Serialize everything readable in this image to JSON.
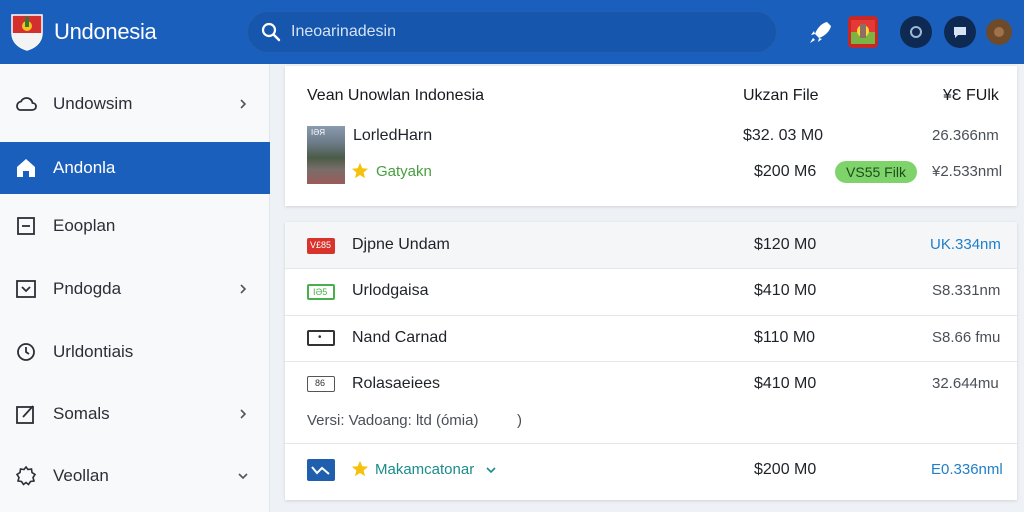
{
  "header": {
    "app_title": "Undonesia",
    "search_placeholder": "Inеоаrinаdеsin"
  },
  "sidebar": {
    "items": [
      {
        "label": "Undowsim",
        "icon": "cloud-icon",
        "chevron": "right",
        "active": false
      },
      {
        "label": "Andonla",
        "icon": "home-icon",
        "chevron": "",
        "active": true
      },
      {
        "label": "Eooplan",
        "icon": "inbox-icon",
        "chevron": "",
        "active": false
      },
      {
        "label": "Pndogda",
        "icon": "download-box-icon",
        "chevron": "right",
        "active": false
      },
      {
        "label": "Urldontiais",
        "icon": "clock-icon",
        "chevron": "",
        "active": false
      },
      {
        "label": "Somals",
        "icon": "edit-icon",
        "chevron": "right",
        "active": false
      },
      {
        "label": "Veollan",
        "icon": "gear-icon",
        "chevron": "down",
        "active": false
      }
    ]
  },
  "top_panel": {
    "title": "Vean Unowlan Indonesia",
    "col2_header": "Ukzan File",
    "col3_header": "¥Ɛ FUlk",
    "thumb_label": "IƏЯ",
    "row1": {
      "name": "LorledHarn",
      "price": "$32. 03 M0",
      "size": "26.366nm"
    },
    "row2": {
      "name": "Gatyakn",
      "price": "$200 M6",
      "badge": "VS55 Filk",
      "size": "¥2.533nml"
    }
  },
  "list_panel": {
    "rows": [
      {
        "tag": "V£85",
        "name": "Djpne Undam",
        "price": "$120 M0",
        "size": "UK.334nm"
      },
      {
        "tag": "IƏ5",
        "name": "Urlodgaisa",
        "price": "$410 M0",
        "size": "S8.331nm"
      },
      {
        "tag": "•",
        "name": "Nand Carnad",
        "price": "$110 M0",
        "size": "S8.66 fmu"
      },
      {
        "tag": "86",
        "name": "Rolasaeiees",
        "price": "$410 M0",
        "size": "32.644mu"
      }
    ],
    "version_line": "Versi: Vadoang: ltd (ómia)",
    "version_suffix": ")",
    "last_row": {
      "name": "Makamcatonar",
      "price": "$200 M0",
      "size": "E0.336nml"
    }
  },
  "colors": {
    "brand_blue": "#1b5fbd",
    "accent_green": "#7fd36b",
    "link_blue": "#1f7fc9",
    "tag_red": "#d9342b",
    "tag_green": "#47b04b"
  }
}
